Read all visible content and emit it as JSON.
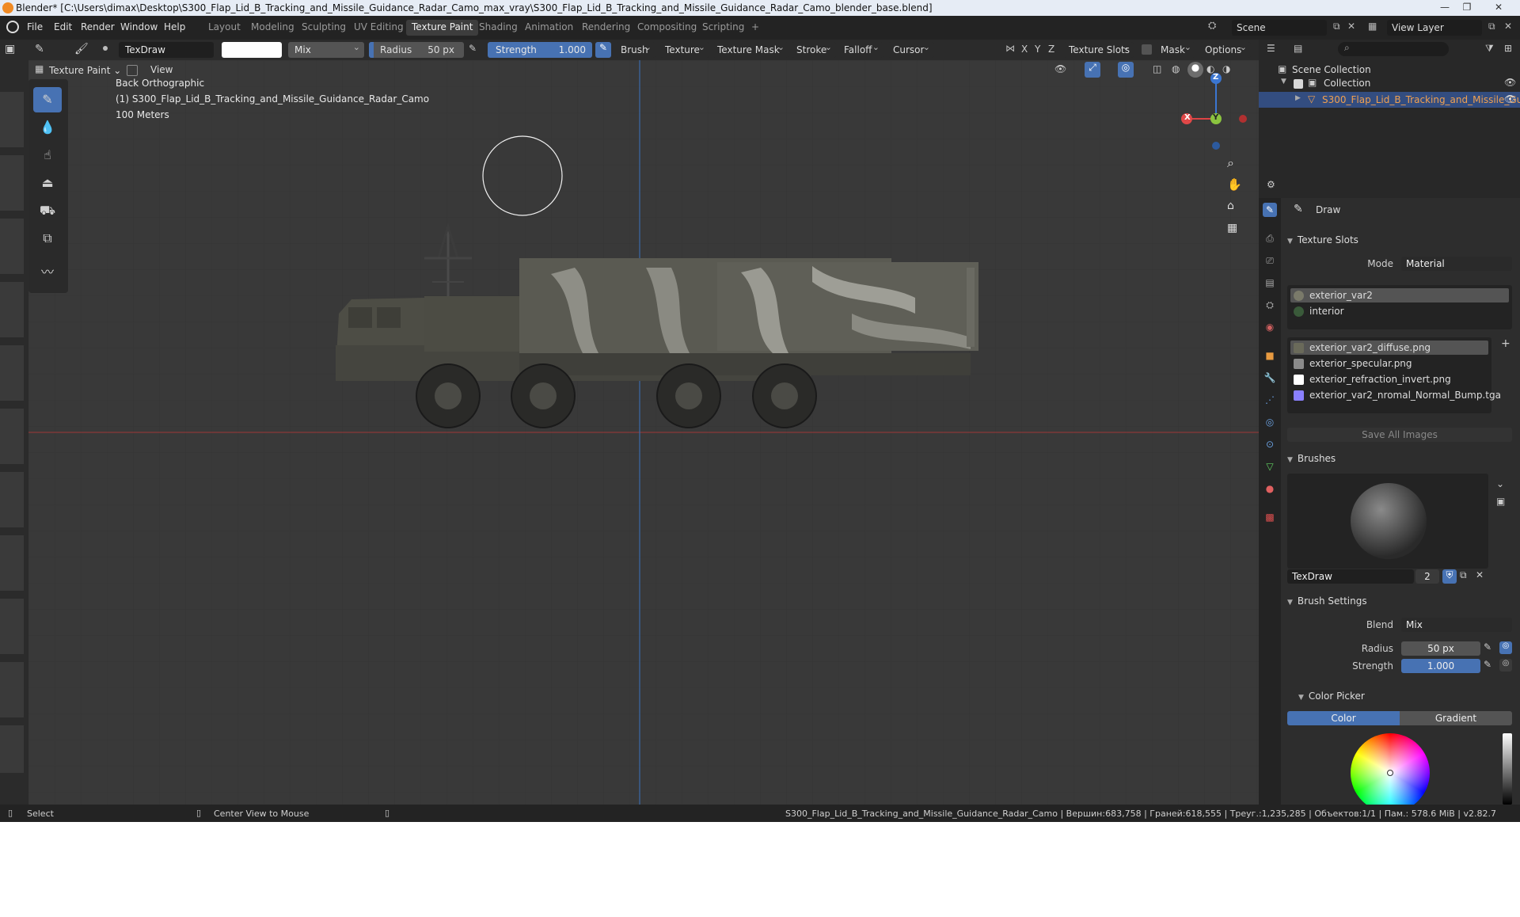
{
  "window": {
    "title": "Blender* [C:\\Users\\dimax\\Desktop\\S300_Flap_Lid_B_Tracking_and_Missile_Guidance_Radar_Camo_max_vray\\S300_Flap_Lid_B_Tracking_and_Missile_Guidance_Radar_Camo_blender_base.blend]"
  },
  "menu": {
    "items": [
      "File",
      "Edit",
      "Render",
      "Window",
      "Help"
    ],
    "workspaces": [
      "Layout",
      "Modeling",
      "Sculpting",
      "UV Editing",
      "Texture Paint",
      "Shading",
      "Animation",
      "Rendering",
      "Compositing",
      "Scripting"
    ],
    "active_workspace": "Texture Paint",
    "add_tab": "+",
    "scene": "Scene",
    "view_layer": "View Layer"
  },
  "toolbar": {
    "brush_name": "TexDraw",
    "blend": "Mix",
    "radius_label": "Radius",
    "radius_value": "50 px",
    "strength_label": "Strength",
    "strength_value": "1.000",
    "dropdowns": [
      "Brush",
      "Texture",
      "Texture Mask",
      "Stroke",
      "Falloff",
      "Cursor"
    ],
    "axes": [
      "X",
      "Y",
      "Z"
    ],
    "texture_slots": "Texture Slots",
    "mask": "Mask",
    "options": "Options"
  },
  "viewport_header": {
    "mode": "Texture Paint",
    "view": "View"
  },
  "viewport": {
    "info_lines": [
      "Back Orthographic",
      "(1) S300_Flap_Lid_B_Tracking_and_Missile_Guidance_Radar_Camo",
      "100 Meters"
    ],
    "gizmo": {
      "x": "X",
      "y": "Y",
      "z": "Z"
    }
  },
  "outliner": {
    "scene_collection": "Scene Collection",
    "collection": "Collection",
    "object": "S300_Flap_Lid_B_Tracking_and_Missile_Gui"
  },
  "properties": {
    "tool_name": "Draw",
    "texture_slots": {
      "header": "Texture Slots",
      "mode_label": "Mode",
      "mode_value": "Material",
      "materials": [
        "exterior_var2",
        "interior"
      ],
      "images": [
        {
          "name": "exterior_var2_diffuse.png",
          "swatch": "#6a6a5a"
        },
        {
          "name": "exterior_specular.png",
          "swatch": "#8a8a8a"
        },
        {
          "name": "exterior_refraction_invert.png",
          "swatch": "#ffffff"
        },
        {
          "name": "exterior_var2_nromal_Normal_Bump.tga",
          "swatch": "#8a80ff"
        }
      ],
      "save_all": "Save All Images"
    },
    "brushes": {
      "header": "Brushes",
      "brush_name": "TexDraw",
      "users": "2"
    },
    "brush_settings": {
      "header": "Brush Settings",
      "blend_label": "Blend",
      "blend_value": "Mix",
      "radius_label": "Radius",
      "radius_value": "50 px",
      "strength_label": "Strength",
      "strength_value": "1.000"
    },
    "color_picker": {
      "header": "Color Picker",
      "tabs": [
        "Color",
        "Gradient"
      ]
    }
  },
  "statusbar": {
    "select": "Select",
    "center_view": "Center View to Mouse",
    "stats": "S300_Flap_Lid_B_Tracking_and_Missile_Guidance_Radar_Camo | Вершин:683,758 | Граней:618,555 | Треуг.:1,235,285 | Объектов:1/1 | Пам.: 578.6 MiB | v2.82.7"
  }
}
